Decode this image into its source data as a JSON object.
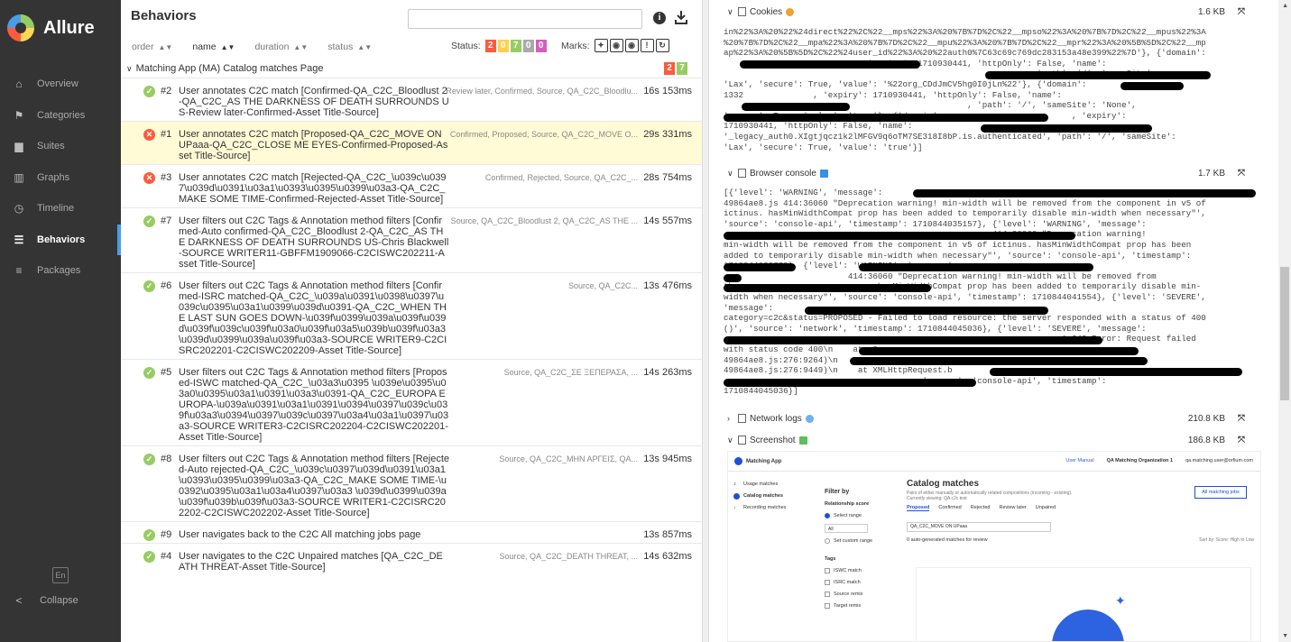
{
  "sidebar": {
    "logo": "Allure",
    "items": [
      {
        "label": "Overview",
        "icon": "home-icon"
      },
      {
        "label": "Categories",
        "icon": "flag-icon"
      },
      {
        "label": "Suites",
        "icon": "briefcase-icon"
      },
      {
        "label": "Graphs",
        "icon": "bar-chart-icon"
      },
      {
        "label": "Timeline",
        "icon": "clock-icon"
      },
      {
        "label": "Behaviors",
        "icon": "list-icon"
      },
      {
        "label": "Packages",
        "icon": "align-left-icon"
      }
    ],
    "lang": "En",
    "collapse": "Collapse"
  },
  "behaviors": {
    "title": "Behaviors",
    "search_placeholder": "",
    "sort": {
      "order": "order",
      "name": "name",
      "duration": "duration",
      "status": "status"
    },
    "status_label": "Status:",
    "status_counts": [
      {
        "value": "2",
        "color": "#fd5a3e"
      },
      {
        "value": "0",
        "color": "#ffd050"
      },
      {
        "value": "7",
        "color": "#97cc64"
      },
      {
        "value": "0",
        "color": "#aaaaaa"
      },
      {
        "value": "0",
        "color": "#d35ebe"
      }
    ],
    "marks_label": "Marks:",
    "group": {
      "label": "Matching App (MA) Catalog matches Page",
      "counts": [
        {
          "value": "2",
          "color": "#fd5a3e"
        },
        {
          "value": "7",
          "color": "#97cc64"
        }
      ]
    },
    "rows": [
      {
        "num": "#2",
        "status": "passed",
        "title": "User annotates C2C match [Confirmed-QA_C2C_Bloodlust 2-QA_C2C_AS THE DARKNESS OF DEATH SURROUNDS US-Review later-Confirmed-Asset Title-Source]",
        "params": "Review later, Confirmed, Source, QA_C2C_Bloodlu...",
        "duration": "16s 153ms",
        "selected": false
      },
      {
        "num": "#1",
        "status": "failed",
        "title": "User annotates C2C match [Proposed-QA_C2C_MOVE ON UPaaa-QA_C2C_CLOSE ME EYES-Confirmed-Proposed-Asset Title-Source]",
        "params": "Confirmed, Proposed, Source, QA_C2C_MOVE O...",
        "duration": "29s 331ms",
        "selected": true
      },
      {
        "num": "#3",
        "status": "failed",
        "title": "User annotates C2C match [Rejected-QA_C2C_\\u039c\\u0397\\u039d\\u0391\\u03a1\\u0393\\u0395\\u0399\\u03a3-QA_C2C_MAKE SOME TIME-Confirmed-Rejected-Asset Title-Source]",
        "params": "Confirmed, Rejected, Source, QA_C2C_...",
        "duration": "28s 754ms",
        "selected": false
      },
      {
        "num": "#7",
        "status": "passed",
        "title": "User filters out C2C Tags & Annotation method filters [Confirmed-Auto confirmed-QA_C2C_Bloodlust 2-QA_C2C_AS THE DARKNESS OF DEATH SURROUNDS US-Chris Blackwell-SOURCE WRITER11-GBFFM1909066-C2CISWC202211-Asset Title-Source]",
        "params": "Source, QA_C2C_Bloodlust 2, QA_C2C_AS THE ...",
        "duration": "14s 557ms",
        "selected": false
      },
      {
        "num": "#6",
        "status": "passed",
        "title": "User filters out C2C Tags & Annotation method filters [Confirmed-ISRC matched-QA_C2C_\\u039a\\u0391\\u0398\\u0397\\u039c\\u0395\\u03a1\\u0399\\u039d\\u0391-QA_C2C_WHEN THE LAST SUN GOES DOWN-\\u039f\\u0399\\u039a\\u039f\\u039d\\u039f\\u039c\\u039f\\u03a0\\u039f\\u03a5\\u039b\\u039f\\u03a3\\u039d\\u0399\\u039a\\u039f\\u03a3-SOURCE WRITER9-C2CISRC202201-C2CISWC202209-Asset Title-Source]",
        "params": "Source, QA_C2C...",
        "duration": "13s 476ms",
        "selected": false
      },
      {
        "num": "#5",
        "status": "passed",
        "title": "User filters out C2C Tags & Annotation method filters [Proposed-ISWC matched-QA_C2C_\\u03a3\\u0395 \\u039e\\u0395\\u03a0\\u0395\\u03a1\\u0391\\u03a3\\u0391-QA_C2C_EUROPA EUROPA-\\u039a\\u0391\\u03a1\\u0391\\u0394\\u0397\\u039c\\u039f\\u03a3\\u0394\\u0397\\u039c\\u0397\\u03a4\\u03a1\\u0397\\u03a3-SOURCE WRITER3-C2CISRC202204-C2CISWC202201-Asset Title-Source]",
        "params": "Source, QA_C2C_ΣΕ ΞΕΠΕΡΑΣΑ, ...",
        "duration": "14s 263ms",
        "selected": false
      },
      {
        "num": "#8",
        "status": "passed",
        "title": "User filters out C2C Tags & Annotation method filters [Rejected-Auto rejected-QA_C2C_\\u039c\\u0397\\u039d\\u0391\\u03a1\\u0393\\u0395\\u0399\\u03a3-QA_C2C_MAKE SOME TIME-\\u0392\\u0395\\u03a1\\u03a4\\u0397\\u03a3 \\u039d\\u0399\\u039a\\u039f\\u039b\\u039f\\u03a3-SOURCE WRITER1-C2CISRC202202-C2CISWC202202-Asset Title-Source]",
        "params": "Source, QA_C2C_ΜΗΝ ΑΡΓΕΙΣ, QA...",
        "duration": "13s 945ms",
        "selected": false
      },
      {
        "num": "#9",
        "status": "passed",
        "title": "User navigates back to the C2C All matching jobs page",
        "params": "",
        "duration": "13s 857ms",
        "selected": false
      },
      {
        "num": "#4",
        "status": "passed",
        "title": "User navigates to the C2C Unpaired matches [QA_C2C_DEATH THREAT-Asset Title-Source]",
        "params": "Source, QA_C2C_DEATH THREAT, ...",
        "duration": "14s 632ms",
        "selected": false
      }
    ]
  },
  "attachments": {
    "cookies": {
      "label": "Cookies",
      "size": "1.6 KB",
      "lines": [
        "in%22%3A%20%22%24direct%22%2C%22__mps%22%3A%20%7B%7D%2C%22__mpso%22%3A%20%7B%7D%2C%22__mpus%22%3A",
        "%20%7B%7D%2C%22__mpa%22%3A%20%7B%7D%2C%22__mpu%22%3A%20%7B%7D%2C%22__mpr%22%3A%20%5B%5D%2C%22__mp",
        "ap%22%3A%20%5B%5D%2C%22%24user_id%22%3A%20%22auth0%7C63c69c769dc283153a48e399%22%7D'}, {'domain':",
        "                           , 'expiry': 1710930441, 'httpOnly': False, 'name':",
        "                                                             , 'path': '/', 'sameSite':",
        "'Lax', 'secure': True, 'value': '%22org_CDdJmCV5hg0I0jLn%22'}, {'domain':",
        "1332              , 'expiry': 1710930441, 'httpOnly': False, 'name':",
        "                                                 , 'path': '/', 'sameSite': 'None',",
        "'secure': True, 'value': 'true'}, {'domain':                          , 'expiry':",
        "1710930441, 'httpOnly': False, 'name':",
        "'_legacy_auth0.XIgtjqcz1k2lMFGV9q6oTM7SE318I8bP.is.authenticated', 'path': '/', 'sameSite':",
        "'Lax', 'secure': True, 'value': 'true'}]"
      ]
    },
    "console": {
      "label": "Browser console",
      "size": "1.7 KB",
      "lines": [
        "[{'level': 'WARNING', 'message':",
        "49864ae8.js 414:36060 \"Deprecation warning! min-width will be removed from the component in v5 of",
        "ictinus. hasMinWidthCompat prop has been added to temporarily disable min-width when necessary\"',",
        "'source': 'console-api', 'timestamp': 1710844035157}, {'level': 'WARNING', 'message':",
        "                                                      414:36060 \"Deprecation warning!",
        "min-width will be removed from the component in v5 of ictinus. hasMinWidthCompat prop has been",
        "added to temporarily disable min-width when necessary\"', 'source': 'console-api', 'timestamp':",
        "1710844038779}, {'level': 'WARNING', 'message':",
        "                         414:36060 \"Deprecation warning! min-width will be removed from",
        "the compone                    hasMinWidthCompat prop has been added to temporarily disable min-",
        "width when necessary\"', 'source': 'console-api', 'timestamp': 1710844041554}, {'level': 'SEVERE',",
        "'message':",
        "category=c2c&status=PROPOSED - Failed to load resource: the server responded with a status of 400",
        "()', 'source': 'network', 'timestamp': 1710844045036}, {'level': 'SEVERE', 'message':",
        "                                                                    1:243 Error: Request failed",
        "with status code 400\\n    at u0",
        "49864ae8.js:276:9264)\\n    at c0",
        "49864ae8.js:276:9449)\\n    at XMLHttpRequest.b",
        "                                      , 'source': 'console-api', 'timestamp':",
        "1710844045036}]"
      ]
    },
    "network": {
      "label": "Network logs",
      "size": "210.8 KB"
    },
    "screenshot": {
      "label": "Screenshot",
      "size": "186.8 KB",
      "app": {
        "title": "Matching App",
        "user_manual": "User Manual",
        "org": "QA Matching Organization 1",
        "user": "qa.matching.user@orfium.com",
        "nav": [
          "Usage matches",
          "Catalog matches",
          "Recording matches"
        ],
        "filter_title": "Filter by",
        "relationship_label": "Relationship score",
        "select_range": "Select range",
        "range_value": "All",
        "custom_range": "Set custom range",
        "tags_label": "Tags",
        "tags": [
          "ISWC match",
          "ISRC match",
          "Source remix",
          "Target remix"
        ],
        "heading": "Catalog matches",
        "subtitle": "Pairs of either manually or automatically related compositions (incoming - existing).",
        "viewing": "Currently viewing: QA c2c test",
        "tabs": [
          "Proposed",
          "Confirmed",
          "Rejected",
          "Review later",
          "Unpaired"
        ],
        "search_value": "QA_C2C_MOVE ON UPaaa",
        "matches_text": "0 auto-generated matches for review",
        "sort_text": "Sort by: Score: High to Low",
        "jobs_button": "All matching jobs"
      }
    }
  }
}
